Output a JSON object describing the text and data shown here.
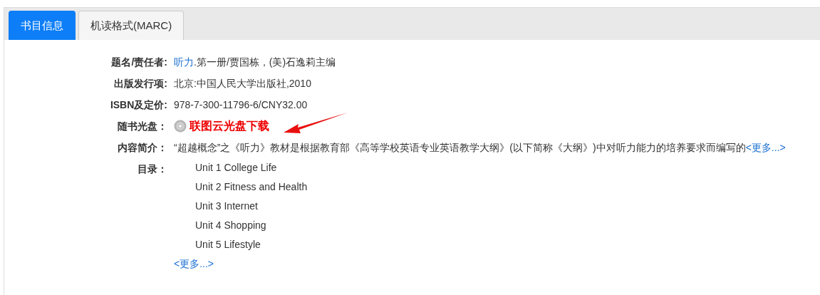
{
  "tabs": [
    {
      "label": "书目信息",
      "selected": true
    },
    {
      "label": "机读格式(MARC)",
      "selected": false
    }
  ],
  "fields": [
    {
      "kind": "title",
      "label": "题名/责任者:",
      "link": "听力",
      "text": ".第一册/贾国栋，(美)石逸莉主编"
    },
    {
      "kind": "text",
      "label": "出版发行项:",
      "value": "北京:中国人民大学出版社,2010"
    },
    {
      "kind": "text",
      "label": "ISBN及定价:",
      "value": "978-7-300-11796-6/CNY32.00"
    },
    {
      "kind": "disc",
      "label": "随书光盘：",
      "link": "联图云光盘下载"
    },
    {
      "kind": "summary",
      "label": "内容简介：",
      "text": "“超越概念”之《听力》教材是根据教育部《高等学校英语专业英语教学大纲》(以下简称《大纲》)中对听力能力的培养要求而编写的",
      "more": "<更多...>"
    },
    {
      "kind": "toc",
      "label": "目录：",
      "items": [
        "Unit 1 College Life",
        "Unit 2 Fitness and Health",
        "Unit 3 Internet",
        "Unit 4 Shopping",
        "Unit 5 Lifestyle"
      ],
      "more": "<更多...>"
    }
  ]
}
